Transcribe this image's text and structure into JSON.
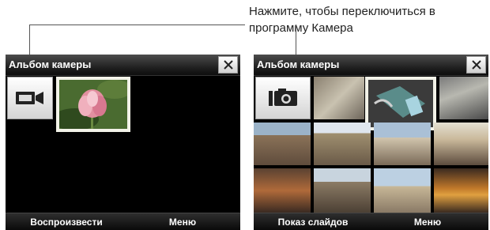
{
  "callout": {
    "line1": "Нажмите, чтобы переключиться в",
    "line2": "программу Камера"
  },
  "left_screen": {
    "title": "Альбом камеры",
    "close_icon": "close-icon",
    "mode_icon": "video-camera-icon",
    "softkey_left": "Воспроизвести",
    "softkey_right": "Меню"
  },
  "right_screen": {
    "title": "Альбом камеры",
    "close_icon": "close-icon",
    "mode_icon": "photo-camera-icon",
    "softkey_left": "Показ слайдов",
    "softkey_right": "Меню"
  },
  "colors": {
    "titlebar": "#1c1c1c",
    "selection_border": "#f2f2e8",
    "callout_line": "#555555"
  }
}
